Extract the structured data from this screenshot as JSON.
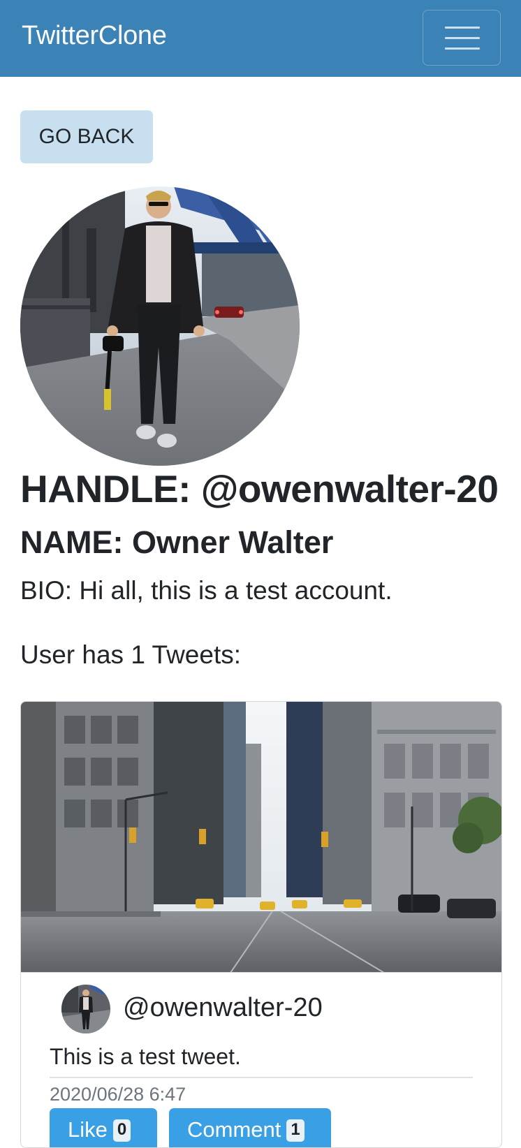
{
  "navbar": {
    "brand": "TwitterClone",
    "toggle_icon": "hamburger-menu-icon",
    "background": "#3b82b6"
  },
  "back_button": {
    "label": "GO BACK"
  },
  "profile": {
    "photo": "profile-photo-man-walking-on-bridge",
    "handle_label": "HANDLE:",
    "handle": "@owenwalter-20",
    "name_label": "NAME:",
    "name": "Owner Walter",
    "bio_label": "BIO:",
    "bio": "Hi all, this is a test account.",
    "tweet_count_text": "User has 1 Tweets:"
  },
  "tweets": [
    {
      "image": "city-street-photo",
      "avatar": "profile-avatar",
      "handle": "@owenwalter-20",
      "text": "This is a test tweet.",
      "timestamp": "2020/06/28 6:47",
      "like_label": "Like",
      "like_count": "0",
      "comment_label": "Comment",
      "comment_count": "1"
    }
  ],
  "colors": {
    "accent": "#3aa0e6",
    "back_button_bg": "#c7dfee",
    "text": "#212529"
  }
}
